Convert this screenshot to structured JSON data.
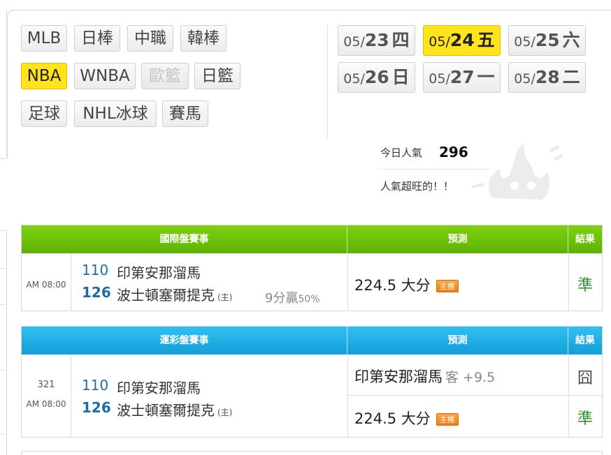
{
  "leagues": [
    {
      "label": "MLB",
      "state": "normal"
    },
    {
      "label": "日棒",
      "state": "normal"
    },
    {
      "label": "中職",
      "state": "normal"
    },
    {
      "label": "韓棒",
      "state": "normal"
    },
    {
      "label": "NBA",
      "state": "active"
    },
    {
      "label": "WNBA",
      "state": "normal"
    },
    {
      "label": "歐籃",
      "state": "disabled"
    },
    {
      "label": "日籃",
      "state": "normal"
    },
    {
      "label": "足球",
      "state": "normal"
    },
    {
      "label": "NHL冰球",
      "state": "normal"
    },
    {
      "label": "賽馬",
      "state": "normal"
    }
  ],
  "dates": [
    {
      "month": "05/",
      "day": "23",
      "weekday": "四",
      "active": false
    },
    {
      "month": "05/",
      "day": "24",
      "weekday": "五",
      "active": true
    },
    {
      "month": "05/",
      "day": "25",
      "weekday": "六",
      "active": false
    },
    {
      "month": "05/",
      "day": "26",
      "weekday": "日",
      "active": false
    },
    {
      "month": "05/",
      "day": "27",
      "weekday": "一",
      "active": false
    },
    {
      "month": "05/",
      "day": "28",
      "weekday": "二",
      "active": false
    }
  ],
  "popularity": {
    "label": "今日人氣",
    "count": "296",
    "message": "人氣超旺的！！"
  },
  "international": {
    "headers": {
      "event": "國際盤賽事",
      "prediction": "預測",
      "result": "結果"
    },
    "time": "AM 08:00",
    "away": {
      "score": "110",
      "team": "印第安那溜馬"
    },
    "home": {
      "score": "126",
      "team": "波士頓塞爾提克",
      "host_mark": "(主)"
    },
    "margin_note": "9分贏",
    "margin_pct": "50%",
    "prediction": "224.5 大分",
    "badge": "主推",
    "result": "準"
  },
  "sports_lottery": {
    "headers": {
      "event": "運彩盤賽事",
      "prediction": "預測",
      "result": "結果"
    },
    "game_number": "321",
    "time": "AM 08:00",
    "away": {
      "score": "110",
      "team": "印第安那溜馬"
    },
    "home": {
      "score": "126",
      "team": "波士頓塞爾提克",
      "host_mark": "(主)"
    },
    "predictions": [
      {
        "text": "印第安那溜馬",
        "side": "客 +9.5",
        "badge": "",
        "result": "囧"
      },
      {
        "text": "224.5 大分",
        "side": "",
        "badge": "主推",
        "result": "準"
      }
    ]
  },
  "colors": {
    "accent_yellow": "#ffe31c",
    "header_green": "#5cb300",
    "header_blue": "#129ed8",
    "score_blue": "#1e6ea3",
    "win_green": "#2f8f2f",
    "badge_orange": "#ee7c10"
  }
}
